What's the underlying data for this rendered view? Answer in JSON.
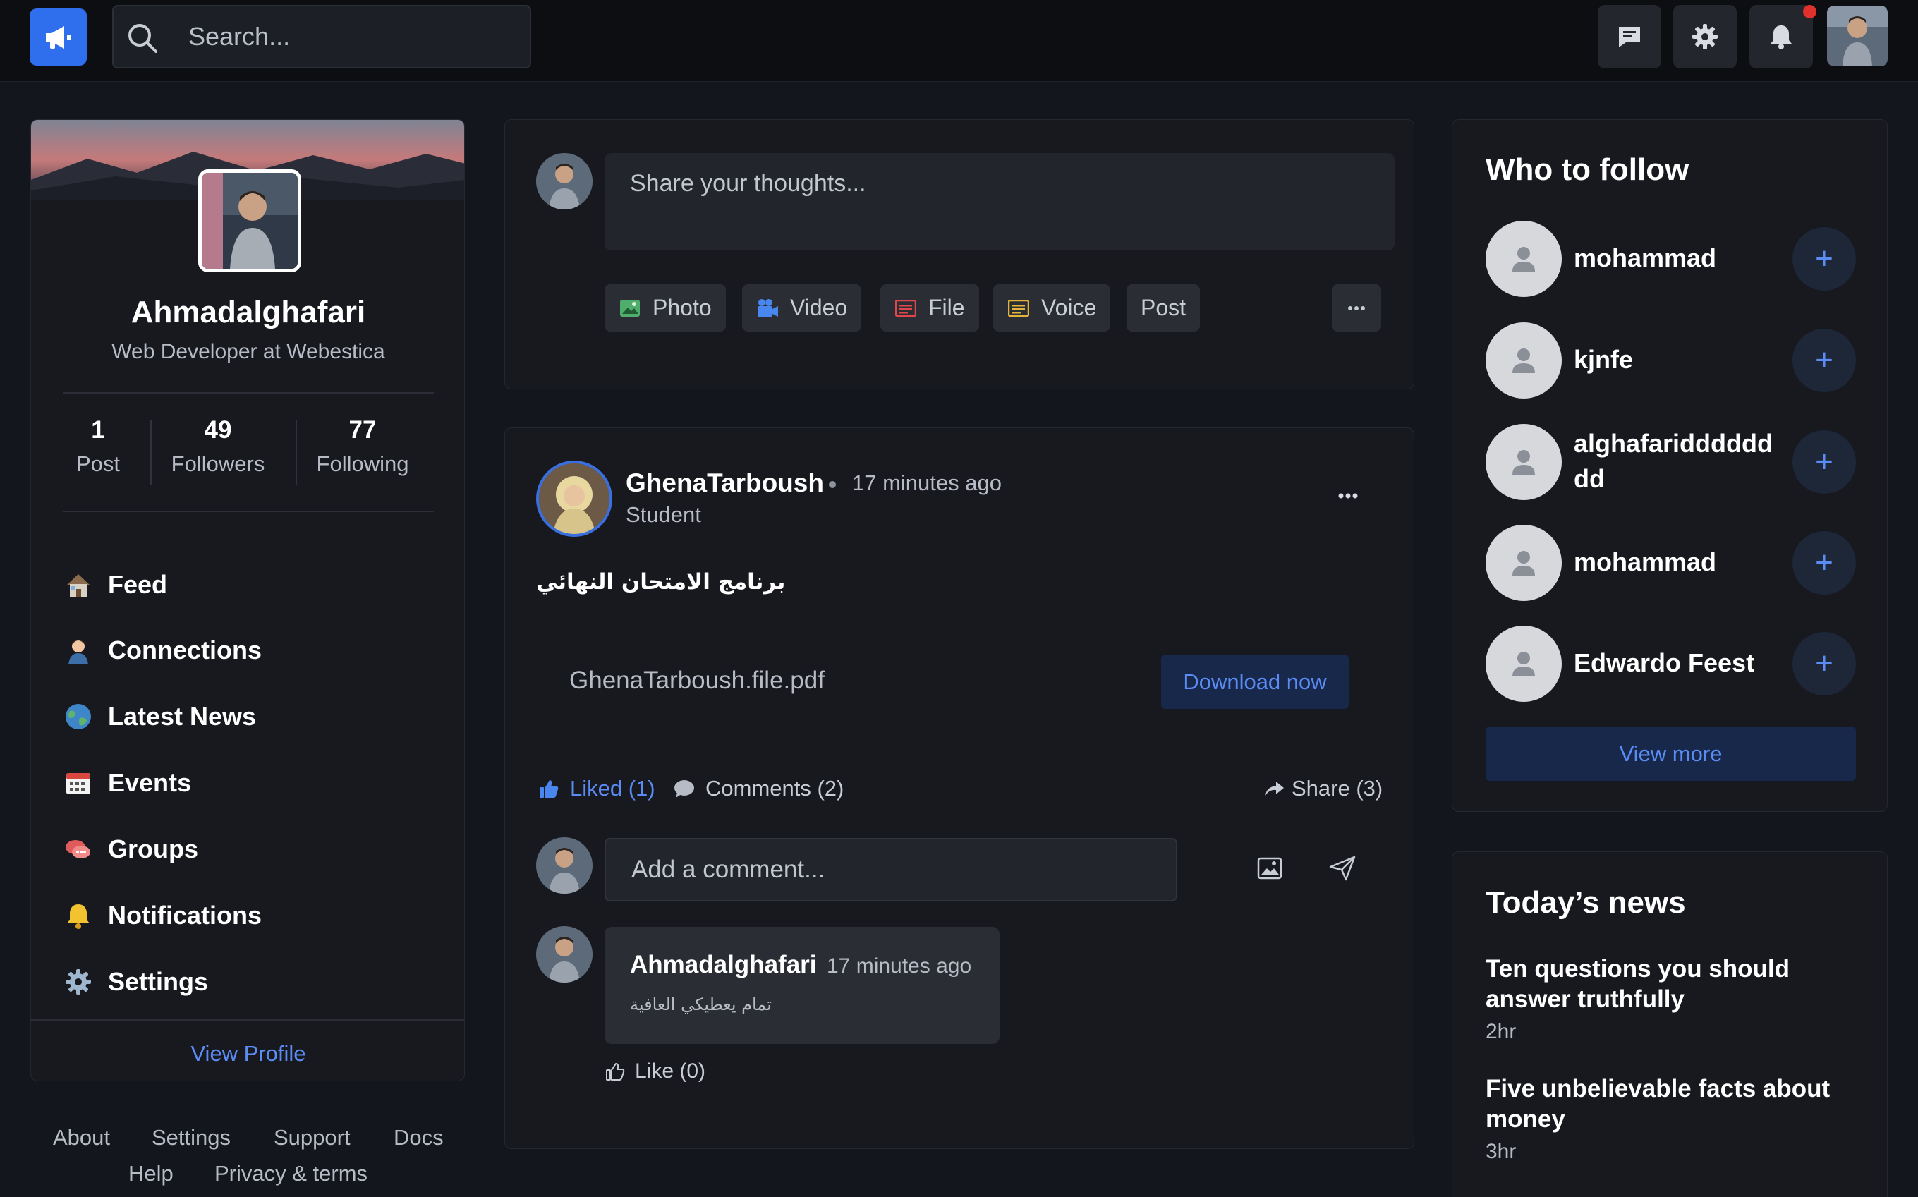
{
  "search": {
    "placeholder": "Search..."
  },
  "profile": {
    "name": "Ahmadalghafari",
    "title": "Web Developer at Webestica",
    "stats": [
      {
        "value": "1",
        "label": "Post"
      },
      {
        "value": "49",
        "label": "Followers"
      },
      {
        "value": "77",
        "label": "Following"
      }
    ],
    "nav": [
      {
        "label": "Feed",
        "icon": "house-icon"
      },
      {
        "label": "Connections",
        "icon": "person-icon"
      },
      {
        "label": "Latest News",
        "icon": "globe-icon"
      },
      {
        "label": "Events",
        "icon": "calendar-icon"
      },
      {
        "label": "Groups",
        "icon": "chat-bubbles-icon"
      },
      {
        "label": "Notifications",
        "icon": "bell-icon"
      },
      {
        "label": "Settings",
        "icon": "gear-icon"
      }
    ],
    "view_profile": "View Profile"
  },
  "footer": {
    "links": [
      "About",
      "Settings",
      "Support",
      "Docs",
      "Help",
      "Privacy & terms"
    ]
  },
  "composer": {
    "placeholder": "Share your thoughts...",
    "chips": [
      "Photo",
      "Video",
      "File",
      "Voice",
      "Post"
    ]
  },
  "post": {
    "author": "GhenaTarboush",
    "time": "17 minutes ago",
    "role": "Student",
    "text": "برنامج الامتحان النهائي",
    "file_name": "GhenaTarboush.file.pdf",
    "download_label": "Download now",
    "liked_label": "Liked (1)",
    "comments_label": "Comments (2)",
    "share_label": "Share (3)",
    "comment_placeholder": "Add a comment...",
    "comment": {
      "author": "Ahmadalghafari",
      "time": "17 minutes ago",
      "text": "تمام يعطيكي العافية",
      "like_label": "Like (0)"
    }
  },
  "who_to_follow": {
    "heading": "Who to follow",
    "people": [
      "mohammad",
      "kjnfe",
      "alghafaridddddd dd",
      "mohammad",
      "Edwardo Feest"
    ],
    "view_more": "View more"
  },
  "news": {
    "heading": "Today’s news",
    "items": [
      {
        "title": "Ten questions you should answer truthfully",
        "age": "2hr"
      },
      {
        "title": "Five unbelievable facts about money",
        "age": "3hr"
      }
    ]
  },
  "colors": {
    "accent": "#2f6fed",
    "link": "#5b8cf5",
    "background": "#14161d",
    "card": "#17191f",
    "notification_dot": "#e0312d"
  }
}
